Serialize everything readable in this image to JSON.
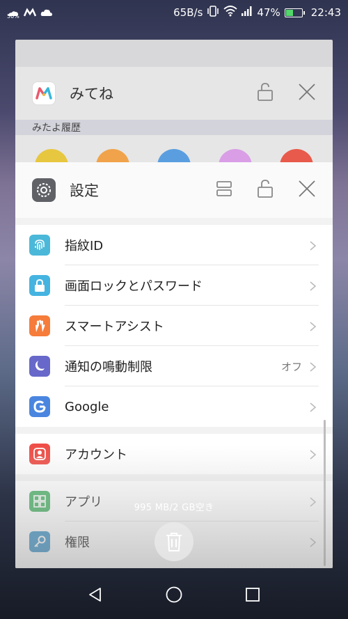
{
  "status_bar": {
    "weather_percent": "50%",
    "speed": "65B/s",
    "battery_percent": "47%",
    "battery_level": 0.47,
    "time": "22:43",
    "icons": [
      "weather-icon",
      "app-notification-icon",
      "cloud-icon",
      "vibrate-icon",
      "wifi-icon",
      "signal-icon",
      "battery-icon"
    ]
  },
  "cards": {
    "mitene": {
      "title": "みてね",
      "subtitle": "みたよ履歴",
      "circle_colors": [
        "#e7c73f",
        "#f0a34a",
        "#5a9ee0",
        "#d99ee6",
        "#e85a4b"
      ]
    },
    "settings": {
      "title": "設定",
      "items": [
        {
          "label": "指紋ID",
          "value": "",
          "icon": "fingerprint-icon",
          "color": "#4bb8d9"
        },
        {
          "label": "画面ロックとパスワード",
          "value": "",
          "icon": "lock-icon",
          "color": "#45b4e1"
        },
        {
          "label": "スマートアシスト",
          "value": "",
          "icon": "hand-icon",
          "color": "#f57c3a"
        },
        {
          "label": "通知の鳴動制限",
          "value": "オフ",
          "icon": "moon-icon",
          "color": "#6768c9"
        },
        {
          "label": "Google",
          "value": "",
          "icon": "google-icon",
          "color": "#4a86e0"
        },
        {
          "label": "アカウント",
          "value": "",
          "icon": "account-icon",
          "color": "#ef4f48"
        },
        {
          "label": "アプリ",
          "value": "",
          "icon": "apps-icon",
          "color": "#3fae5d"
        },
        {
          "label": "権限",
          "value": "",
          "icon": "key-icon",
          "color": "#3b92c7"
        }
      ]
    }
  },
  "memory_text": "995 MB/2 GB空き",
  "nav": [
    "back-icon",
    "home-icon",
    "recents-icon"
  ]
}
